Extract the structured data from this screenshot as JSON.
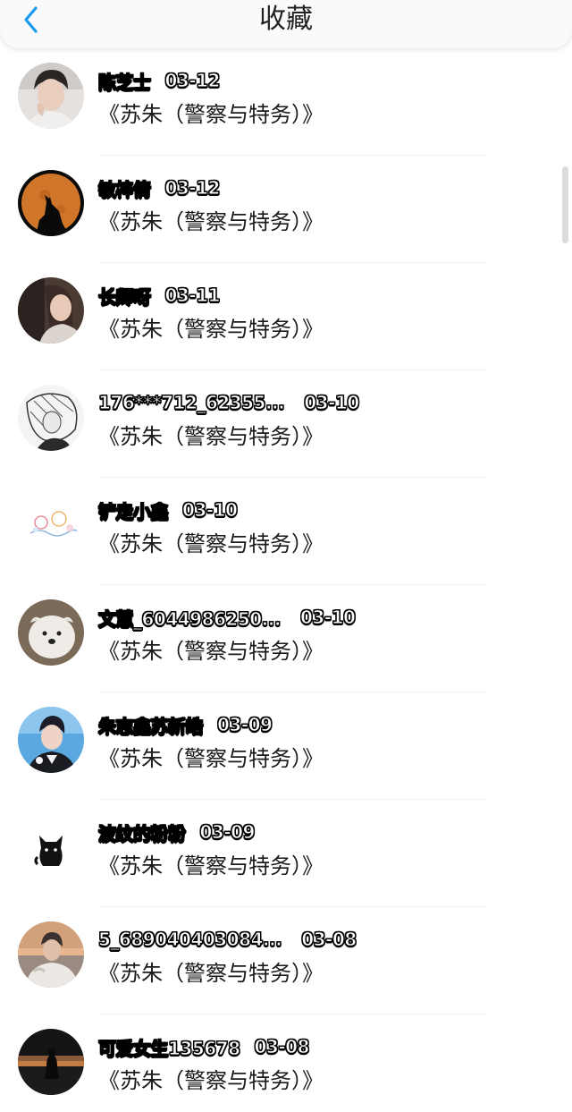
{
  "header": {
    "title": "收藏",
    "back_icon": "chevron-left-icon",
    "accent_color": "#1a9bf0"
  },
  "items": [
    {
      "name": "陈芝士",
      "date": "03-12",
      "title": "《苏朱（警察与特务）》",
      "avatar": "portrait-photo"
    },
    {
      "name": "敏梓倩",
      "date": "03-12",
      "title": "《苏朱（警察与特务）》",
      "avatar": "wolf-moon"
    },
    {
      "name": "长卿呀",
      "date": "03-11",
      "title": "《苏朱（警察与特务）》",
      "avatar": "girl-photo"
    },
    {
      "name": "176***712_62355...",
      "date": "03-10",
      "title": "《苏朱（警察与特务）》",
      "avatar": "manga-sketch"
    },
    {
      "name": "铲走小鑫",
      "date": "03-10",
      "title": "《苏朱（警察与特务）》",
      "avatar": "cartoon-doodle"
    },
    {
      "name": "文慧_6044986250...",
      "date": "03-10",
      "title": "《苏朱（警察与特务）》",
      "avatar": "white-dog"
    },
    {
      "name": "朱志鑫苏新皓",
      "date": "03-09",
      "title": "《苏朱（警察与特务）》",
      "avatar": "stage-photo"
    },
    {
      "name": "波纹的粉粉",
      "date": "03-09",
      "title": "《苏朱（警察与特务）》",
      "avatar": "black-cat"
    },
    {
      "name": "5_689040403084...",
      "date": "03-08",
      "title": "《苏朱（警察与特务）》",
      "avatar": "sunset-portrait"
    },
    {
      "name": "可爱女生135678",
      "date": "03-08",
      "title": "《苏朱（警察与特务）》",
      "avatar": "night-silhouette"
    }
  ]
}
